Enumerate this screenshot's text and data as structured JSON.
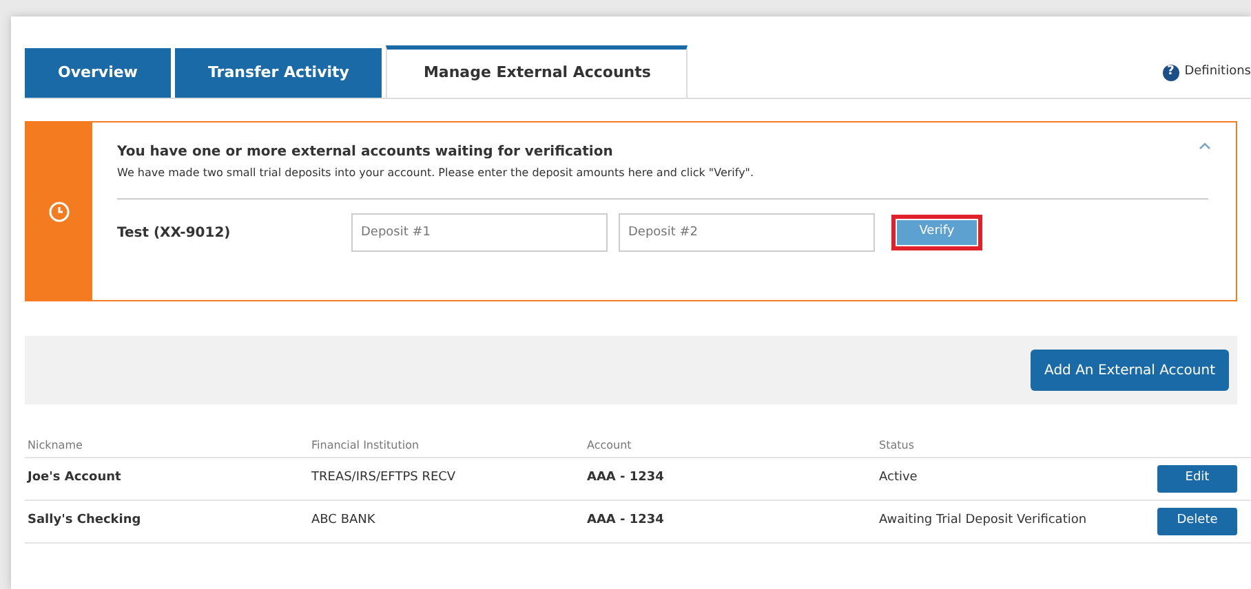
{
  "tabs": [
    {
      "label": "Overview",
      "selected": false
    },
    {
      "label": "Transfer Activity",
      "selected": false
    },
    {
      "label": "Manage External Accounts",
      "selected": true
    }
  ],
  "definitions_link": {
    "icon": "?",
    "label": "Definitions"
  },
  "alert": {
    "title": "You have one or more external accounts waiting for verification",
    "message": "We have made two small trial deposits into your account. Please enter the deposit amounts here and click \"Verify\".",
    "expanded": true,
    "account": "Test (XX-9012)",
    "fields": [
      {
        "placeholder": "Deposit #1"
      },
      {
        "placeholder": "Deposit #2"
      }
    ],
    "verify_button": {
      "label": "Verify",
      "highlighted": true
    }
  },
  "add_button": "Add An External Account",
  "table": {
    "columns": [
      "Nickname",
      "Financial Institution",
      "Account",
      "Status"
    ],
    "rows": [
      {
        "nickname": "Joe's Account",
        "institution": "TREAS/IRS/EFTPS RECV",
        "account": "AAA - 1234",
        "status": "Active",
        "action": "Edit"
      },
      {
        "nickname": "Sally's Checking",
        "institution": "ABC BANK",
        "account": "AAA - 1234",
        "status": "Awaiting Trial Deposit Verification",
        "action": "Delete"
      }
    ]
  }
}
